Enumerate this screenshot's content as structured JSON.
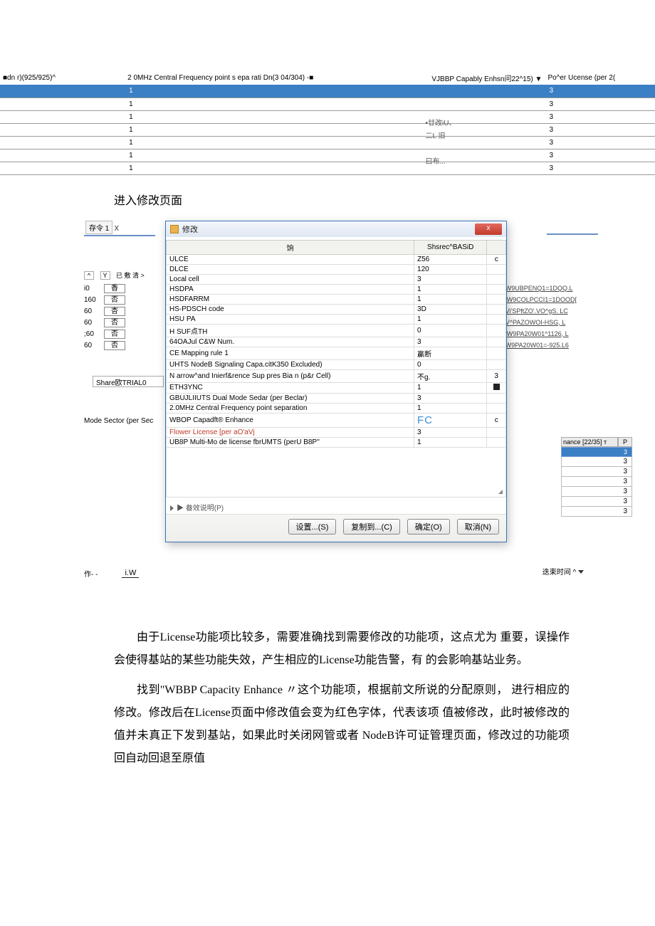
{
  "top_headers": {
    "h1": "■dn r)(925/925)^",
    "h2": "2 0MHz Central Frequency point s epa rati Dn(3 04/304) -■",
    "h3": "VJBBP Capably Enhsn问22^15) ▼",
    "h4": "Po^er Ucense (per 2("
  },
  "top_blue": {
    "left": "1",
    "right": "3"
  },
  "top_rows": [
    {
      "c2": "1",
      "c3": "",
      "c4": "3"
    },
    {
      "c2": "1",
      "c3": "•廿改iU、",
      "c4": "3"
    },
    {
      "c2": "1",
      "c3": "二L 旧",
      "c4": "3"
    },
    {
      "c2": "1",
      "c3": "",
      "c4": "3"
    },
    {
      "c2": "1",
      "c3": "曰布...",
      "c4": "3"
    },
    {
      "c2": "1",
      "c3": "",
      "c4": "3"
    }
  ],
  "caption1": "进入修改页面",
  "bg": {
    "tab": "存令 1",
    "filter_label": "已 敷 清 >",
    "rows": [
      {
        "n": "i0",
        "v": "香"
      },
      {
        "n": "160",
        "v": "否"
      },
      {
        "n": "60",
        "v": "杏"
      },
      {
        "n": "60",
        "v": "否"
      },
      {
        "n": ";60",
        "v": "否"
      },
      {
        "n": "60",
        "v": "否"
      }
    ],
    "cmd_value": "Share欧TRIAL0",
    "mode_label": "Mode Sector (per Sec",
    "action_prefix": "作- -",
    "action_iw": "i.W"
  },
  "right_labels": [
    "0W9UBPENQ1=1DQQ.L",
    "QW9COLPCCI1=1DOOD[",
    "0Vi'SPftZO'.VO^gS. LC",
    "0V^PAZOWOI-HSG, L",
    "QW9PA20W01^1126, L",
    "0W9PA20W01=-925.L6"
  ],
  "right_peek": {
    "hdr_left": "nance [22/35] т",
    "hdr_right": "P",
    "bluerow": "3",
    "cells": [
      "3",
      "3",
      "3",
      "3",
      "3",
      "3"
    ]
  },
  "right_end": {
    "label": "迭束时间 ^"
  },
  "dialog": {
    "title": "修改",
    "header_name": "饷",
    "header_val": "Shsrec^BASiD",
    "rows": [
      {
        "name": "ULCE",
        "val": "Z56",
        "extra": "c"
      },
      {
        "name": "DLCE",
        "val": "120",
        "extra": ""
      },
      {
        "name": "Local cell",
        "val": "3",
        "extra": ""
      },
      {
        "name": "HSDPA",
        "val": "1",
        "extra": ""
      },
      {
        "name": "HSDFARRM",
        "val": "1",
        "extra": ""
      },
      {
        "name": "HS-PDSCH code",
        "val": "3D",
        "extra": ""
      },
      {
        "name": "HSU PA",
        "val": "1",
        "extra": ""
      },
      {
        "name": "H SUF点TH",
        "val": "0",
        "extra": ""
      },
      {
        "name": "64OAJul C&W Num.",
        "val": "3",
        "extra": ""
      },
      {
        "name": "CE Mapping rule 1",
        "val": "贏断",
        "extra": ""
      },
      {
        "name": "UHTS NodeB Signaling Capa.citK350 Excluded)",
        "val": "0",
        "extra": ""
      },
      {
        "name": "N arrow^and Inierf&rence Sup pres Bia n (p&r Cell)",
        "val": "不g.",
        "extra": "3"
      },
      {
        "name": "ETH3YNC",
        "val": "1",
        "extra": "■"
      },
      {
        "name": "GBUJLIIUTS Dual Mode Sedar (per Beclar)",
        "val": "3",
        "extra": ""
      },
      {
        "name": "2.0MHz Central Frequency point separation",
        "val": "1",
        "extra": ""
      },
      {
        "name": "WBOP Capadft® Enhance",
        "val": "FC",
        "extra": "c"
      },
      {
        "name": "Flower License [per aO'aVj",
        "val": "3",
        "extra": ""
      },
      {
        "name": "UB8P Multi-Mo de license fbrUMTS (perU B8P''",
        "val": "1",
        "extra": ""
      }
    ],
    "red_name": "Flower License [per aO'aVj",
    "disclosure": "▶ 畚效说明(P)",
    "buttons": {
      "set": "设置...(S)",
      "copy": "复制到...(C)",
      "ok": "确定(O)",
      "cancel": "取消(N)"
    }
  },
  "para1": "由于License功能项比较多，需要准确找到需要修改的功能项，这点尤为 重要，误操作会使得基站的某些功能失效，产生相应的License功能告警，有 的会影响基站业务。",
  "para2": "找到\"WBBP Capacity Enhance 〃这个功能项，根据前文所说的分配原则， 进行相应的修改。修改后在License页面中修改值会变为红色字体，代表该项 值被修改，此时被修改的值并未真正下发到基站，如果此时关闭网管或者 NodeB许可证管理页面，修改过的功能项回自动回退至原值"
}
